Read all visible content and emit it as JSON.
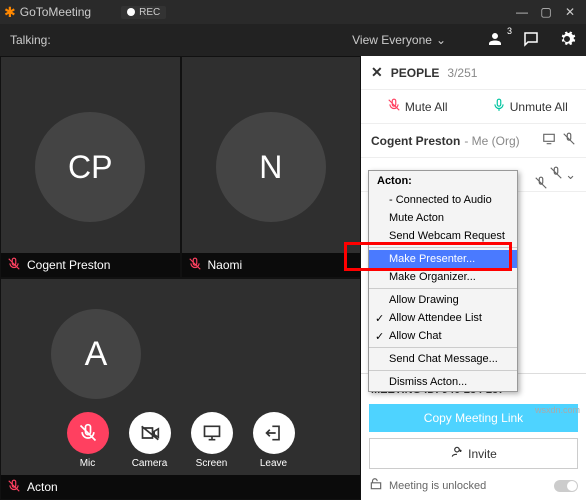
{
  "titlebar": {
    "appname": "GoToMeeting",
    "rec": "REC"
  },
  "toolbar": {
    "talking": "Talking:",
    "view": "View Everyone",
    "people_count": "3"
  },
  "tiles": {
    "a": {
      "initials": "CP",
      "name": "Cogent Preston"
    },
    "b": {
      "initials": "N",
      "name": "Naomi"
    },
    "c": {
      "initials": "A",
      "name": "Acton"
    }
  },
  "controls": {
    "mic": "Mic",
    "camera": "Camera",
    "screen": "Screen",
    "leave": "Leave"
  },
  "panel": {
    "title": "PEOPLE",
    "count": "3/251",
    "mute_all": "Mute All",
    "unmute_all": "Unmute All",
    "self_name": "Cogent Preston",
    "self_role": " - Me (Org)",
    "attendee": "Acton"
  },
  "ctx": {
    "title": "Acton:",
    "items": [
      "- Connected to Audio",
      "Mute Acton",
      "Send Webcam Request",
      "Make Presenter...",
      "Make Organizer...",
      "Allow Drawing",
      "Allow Attendee List",
      "Allow Chat",
      "Send Chat Message...",
      "Dismiss Acton..."
    ]
  },
  "footer": {
    "mid_label": "MEETING ID:",
    "mid_value": "940-234-237",
    "copy": "Copy Meeting Link",
    "invite": "Invite",
    "unlock": "Meeting is unlocked"
  },
  "watermark": "wsxdn.com"
}
